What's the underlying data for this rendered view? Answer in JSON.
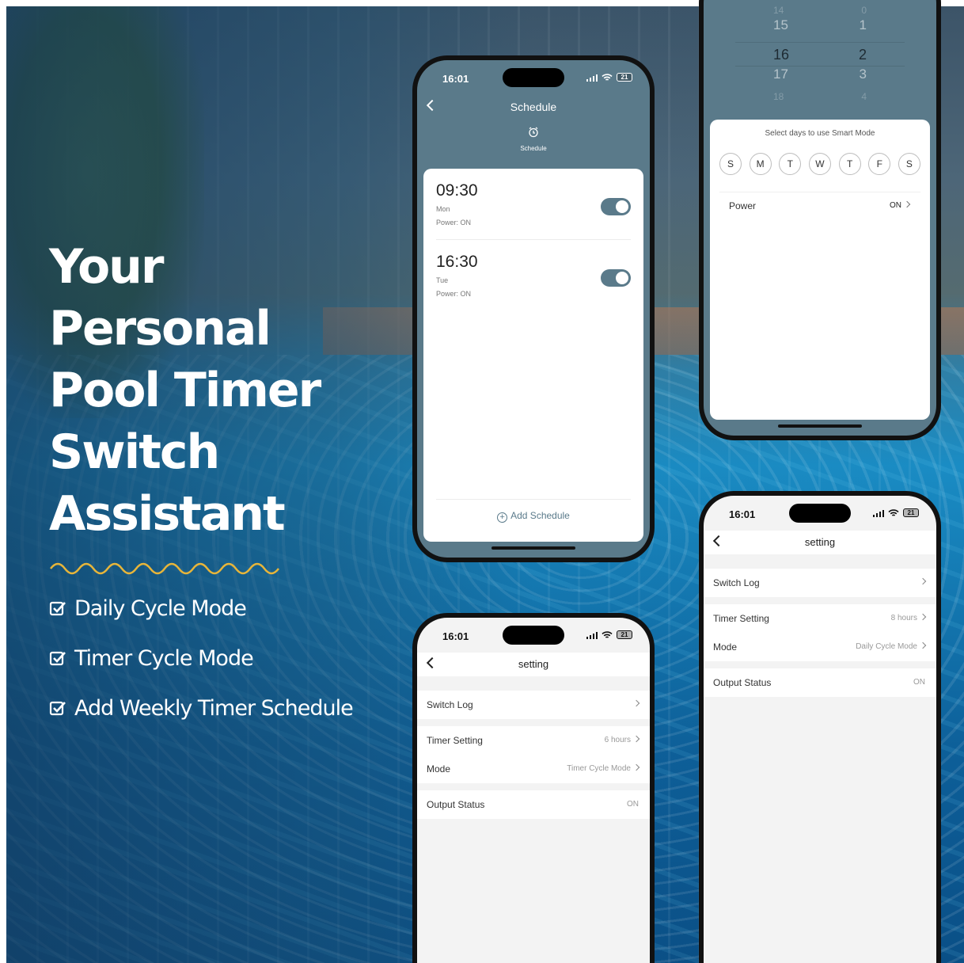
{
  "headline": [
    "Your",
    "Personal",
    "Pool Timer",
    "Switch",
    "Assistant"
  ],
  "features": [
    "Daily Cycle Mode",
    "Timer Cycle Mode",
    "Add Weekly Timer Schedule"
  ],
  "colors": {
    "accent": "#5a7a8a",
    "wave": "#e7b53a",
    "text_light": "#ffffff"
  },
  "icons": {
    "checkbox": "checkbox-icon",
    "back": "chevron-left-icon",
    "alarm": "alarm-clock-icon",
    "add": "plus-circle-icon",
    "chevron": "chevron-right-icon"
  },
  "status_bar": {
    "time": "16:01",
    "battery": "21"
  },
  "schedule_screen": {
    "title": "Schedule",
    "tab_label": "Schedule",
    "items": [
      {
        "time": "09:30",
        "day": "Mon",
        "power": "Power: ON",
        "enabled": true
      },
      {
        "time": "16:30",
        "day": "Tue",
        "power": "Power: ON",
        "enabled": true
      }
    ],
    "add_label": "Add Schedule"
  },
  "smart_screen": {
    "picker": [
      {
        "a": "14",
        "b": "0",
        "state": "dim"
      },
      {
        "a": "15",
        "b": "1",
        "state": ""
      },
      {
        "a": "16",
        "b": "2",
        "state": "sel"
      },
      {
        "a": "17",
        "b": "3",
        "state": ""
      },
      {
        "a": "18",
        "b": "4",
        "state": "dim"
      }
    ],
    "title": "Select days to use Smart Mode",
    "days": [
      "S",
      "M",
      "T",
      "W",
      "T",
      "F",
      "S"
    ],
    "power_label": "Power",
    "power_value": "ON"
  },
  "setting_screen_1": {
    "title": "setting",
    "switch_log": "Switch Log",
    "timer_setting": "Timer Setting",
    "timer_value": "6 hours",
    "mode": "Mode",
    "mode_value": "Timer Cycle Mode",
    "output_status": "Output Status",
    "output_value": "ON"
  },
  "setting_screen_2": {
    "title": "setting",
    "switch_log": "Switch Log",
    "timer_setting": "Timer Setting",
    "timer_value": "8 hours",
    "mode": "Mode",
    "mode_value": "Daily Cycle Mode",
    "output_status": "Output Status",
    "output_value": "ON"
  }
}
